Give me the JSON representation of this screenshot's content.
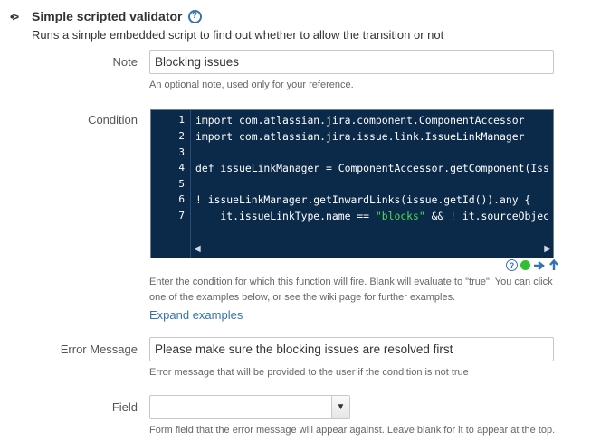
{
  "header": {
    "title": "Simple scripted validator",
    "description": "Runs a simple embedded script to find out whether to allow the transition or not"
  },
  "note": {
    "label": "Note",
    "value": "Blocking issues",
    "hint": "An optional note, used only for your reference."
  },
  "condition": {
    "label": "Condition",
    "line_numbers": [
      "1",
      "2",
      "3",
      "4",
      "5",
      "6",
      "7"
    ],
    "code_lines": [
      "import com.atlassian.jira.component.ComponentAccessor",
      "import com.atlassian.jira.issue.link.IssueLinkManager",
      "",
      "def issueLinkManager = ComponentAccessor.getComponent(Iss",
      "",
      "! issueLinkManager.getInwardLinks(issue.getId()).any {",
      "    it.issueLinkType.name == "
    ],
    "code_line7_string": "\"blocks\"",
    "code_line7_rest": " && ! it.sourceObjec",
    "hint_line1": "Enter the condition for which this function will fire. Blank will evaluate to \"true\". You can click",
    "hint_line2": "one of the examples below, or see the wiki page for further examples.",
    "expand_link": "Expand examples",
    "icons": [
      "help-icon",
      "green-status-icon",
      "arrow-right-icon",
      "arrow-up-icon"
    ],
    "colors": {
      "editor_bg": "#0b2a4a",
      "string": "#4fdc4f"
    }
  },
  "error_message": {
    "label": "Error Message",
    "value": "Please make sure the blocking issues are resolved first",
    "hint": "Error message that will be provided to the user if the condition is not true"
  },
  "field": {
    "label": "Field",
    "selected": "",
    "hint": "Form field that the error message will appear against. Leave blank for it to appear at the top."
  },
  "colors": {
    "link": "#3572b0",
    "accent": "#3572b0"
  }
}
